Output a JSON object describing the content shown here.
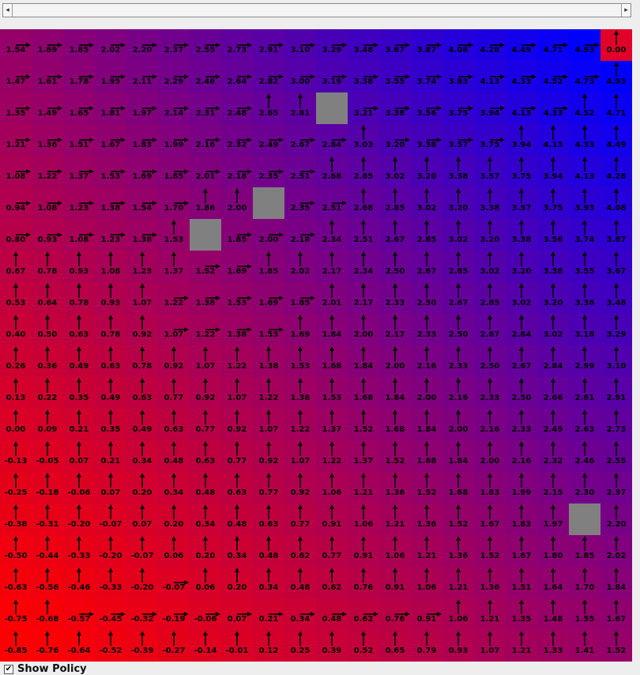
{
  "colors": {
    "low": "#ff0000",
    "high": "#0000ff",
    "obstacle": "#808080",
    "goal": "#e0002a"
  },
  "controls": {
    "show_policy_label": "Show Policy",
    "show_policy_checked": true,
    "check_glyph": "✔"
  },
  "scrollbar": {
    "left_icon": "◂",
    "right_icon": "▸"
  },
  "grid": {
    "rows": 20,
    "cols": 20,
    "goal": [
      0,
      19
    ],
    "obstacles": [
      [
        2,
        10
      ],
      [
        5,
        8
      ],
      [
        6,
        6
      ],
      [
        15,
        18
      ]
    ],
    "values": [
      [
        "1.54",
        "1.69",
        "1.85",
        "2.02",
        "2.20",
        "2.37",
        "2.55",
        "2.73",
        "2.91",
        "3.10",
        "3.29",
        "3.48",
        "3.67",
        "3.87",
        "4.08",
        "4.28",
        "4.49",
        "4.71",
        "4.93",
        "0.00"
      ],
      [
        "1.47",
        "1.61",
        "1.78",
        "1.95",
        "2.11",
        "2.29",
        "2.46",
        "2.64",
        "2.82",
        "3.00",
        "3.19",
        "3.38",
        "3.55",
        "3.74",
        "3.93",
        "4.13",
        "4.33",
        "4.52",
        "4.73",
        "4.93"
      ],
      [
        "1.35",
        "1.49",
        "1.65",
        "1.81",
        "1.97",
        "2.14",
        "2.31",
        "2.48",
        "2.65",
        "2.81",
        "",
        "3.21",
        "3.38",
        "3.56",
        "3.75",
        "3.94",
        "4.13",
        "4.33",
        "4.52",
        "4.71"
      ],
      [
        "1.21",
        "1.36",
        "1.51",
        "1.67",
        "1.83",
        "1.99",
        "2.16",
        "2.32",
        "2.49",
        "2.67",
        "2.84",
        "3.03",
        "3.20",
        "3.38",
        "3.57",
        "3.75",
        "3.94",
        "4.13",
        "4.33",
        "4.49"
      ],
      [
        "1.08",
        "1.22",
        "1.37",
        "1.53",
        "1.69",
        "1.85",
        "2.01",
        "2.18",
        "2.35",
        "2.51",
        "2.68",
        "2.85",
        "3.02",
        "3.20",
        "3.38",
        "3.57",
        "3.75",
        "3.94",
        "4.13",
        "4.28"
      ],
      [
        "0.94",
        "1.08",
        "1.23",
        "1.38",
        "1.54",
        "1.70",
        "1.86",
        "2.00",
        "",
        "2.35",
        "2.51",
        "2.68",
        "2.85",
        "3.02",
        "3.20",
        "3.38",
        "3.57",
        "3.75",
        "3.93",
        "4.08"
      ],
      [
        "0.80",
        "0.93",
        "1.08",
        "1.23",
        "1.38",
        "1.53",
        "",
        "1.85",
        "2.00",
        "2.18",
        "2.34",
        "2.51",
        "2.67",
        "2.85",
        "3.02",
        "3.20",
        "3.38",
        "3.56",
        "3.74",
        "3.87"
      ],
      [
        "0.67",
        "0.78",
        "0.93",
        "1.08",
        "1.23",
        "1.37",
        "1.52",
        "1.69",
        "1.85",
        "2.02",
        "2.17",
        "2.34",
        "2.50",
        "2.67",
        "2.85",
        "3.02",
        "3.20",
        "3.38",
        "3.55",
        "3.67"
      ],
      [
        "0.53",
        "0.64",
        "0.78",
        "0.93",
        "1.07",
        "1.22",
        "1.38",
        "1.53",
        "1.69",
        "1.85",
        "2.01",
        "2.17",
        "2.33",
        "2.50",
        "2.67",
        "2.85",
        "3.02",
        "3.20",
        "3.36",
        "3.48"
      ],
      [
        "0.40",
        "0.50",
        "0.63",
        "0.78",
        "0.92",
        "1.07",
        "1.22",
        "1.38",
        "1.53",
        "1.69",
        "1.84",
        "2.00",
        "2.17",
        "2.33",
        "2.50",
        "2.67",
        "2.84",
        "3.02",
        "3.18",
        "3.29"
      ],
      [
        "0.26",
        "0.36",
        "0.49",
        "0.63",
        "0.78",
        "0.92",
        "1.07",
        "1.22",
        "1.38",
        "1.53",
        "1.68",
        "1.84",
        "2.00",
        "2.16",
        "2.33",
        "2.50",
        "2.67",
        "2.84",
        "2.99",
        "3.10"
      ],
      [
        "0.13",
        "0.22",
        "0.35",
        "0.49",
        "0.63",
        "0.77",
        "0.92",
        "1.07",
        "1.22",
        "1.38",
        "1.53",
        "1.68",
        "1.84",
        "2.00",
        "2.16",
        "2.33",
        "2.50",
        "2.66",
        "2.81",
        "2.91"
      ],
      [
        "0.00",
        "0.09",
        "0.21",
        "0.35",
        "0.49",
        "0.63",
        "0.77",
        "0.92",
        "1.07",
        "1.22",
        "1.37",
        "1.52",
        "1.68",
        "1.84",
        "2.00",
        "2.16",
        "2.33",
        "2.49",
        "2.63",
        "2.73"
      ],
      [
        "-0.13",
        "-0.05",
        "0.07",
        "0.21",
        "0.34",
        "0.48",
        "0.63",
        "0.77",
        "0.92",
        "1.07",
        "1.22",
        "1.37",
        "1.52",
        "1.68",
        "1.84",
        "2.00",
        "2.16",
        "2.32",
        "2.46",
        "2.55"
      ],
      [
        "-0.25",
        "-0.18",
        "-0.06",
        "0.07",
        "0.20",
        "0.34",
        "0.48",
        "0.63",
        "0.77",
        "0.92",
        "1.06",
        "1.21",
        "1.36",
        "1.52",
        "1.68",
        "1.83",
        "1.99",
        "2.15",
        "2.30",
        "2.37"
      ],
      [
        "-0.38",
        "-0.31",
        "-0.20",
        "-0.07",
        "0.07",
        "0.20",
        "0.34",
        "0.48",
        "0.63",
        "0.77",
        "0.91",
        "1.06",
        "1.21",
        "1.36",
        "1.52",
        "1.67",
        "1.83",
        "1.97",
        "",
        "2.20"
      ],
      [
        "-0.50",
        "-0.44",
        "-0.33",
        "-0.20",
        "-0.07",
        "0.06",
        "0.20",
        "0.34",
        "0.48",
        "0.62",
        "0.77",
        "0.91",
        "1.06",
        "1.21",
        "1.36",
        "1.52",
        "1.67",
        "1.80",
        "1.85",
        "2.02"
      ],
      [
        "-0.63",
        "-0.56",
        "-0.46",
        "-0.33",
        "-0.20",
        "-0.07",
        "0.06",
        "0.20",
        "0.34",
        "0.48",
        "0.62",
        "0.76",
        "0.91",
        "1.06",
        "1.21",
        "1.36",
        "1.51",
        "1.64",
        "1.70",
        "1.84"
      ],
      [
        "-0.75",
        "-0.68",
        "-0.57",
        "-0.45",
        "-0.32",
        "-0.19",
        "-0.06",
        "0.07",
        "0.21",
        "0.34",
        "0.48",
        "0.62",
        "0.76",
        "0.91",
        "1.06",
        "1.21",
        "1.35",
        "1.48",
        "1.55",
        "1.67"
      ],
      [
        "-0.85",
        "-0.76",
        "-0.64",
        "-0.52",
        "-0.39",
        "-0.27",
        "-0.14",
        "-0.01",
        "0.12",
        "0.25",
        "0.39",
        "0.52",
        "0.65",
        "0.79",
        "0.93",
        "1.07",
        "1.21",
        "1.33",
        "1.41",
        "1.52"
      ]
    ],
    "policy": [
      "RRRRRRRRRRRRRRRRRRRU",
      "RRRRRRRRRRRRRRRRRRRU",
      "RRRRRRRRUU.RRRRRRRUU",
      "RRRRRRRRRRRURRRRUUUU",
      "RRRRRRRRRRUUUUUUUUUU",
      "RRRRRRUU.RRUUUUUUUUU",
      "RRRRRU.RRRUUUUUUUUUU",
      "UUUUUURRUUUUUUUUUUUU",
      "UUUUURRRRRUUUUUUUUUU",
      "UUUUURRRRUUUUUUUUUUU",
      "UUUUUUUUUUUUUUUUUUUU",
      "UUUUUUUUUUUUUUUUUUUU",
      "UUUUUUUUUUUUUUUUUUUU",
      "UUUUUUUUUUUUUUUUUUUU",
      "UUUUUUUUUUUUUUUUUUUU",
      "UUUUUUUUUUUUUUUUUU.U",
      "UUUUUUUUUUUUUUUUUUUU",
      "UUUUURUUUUUUUUUUUUUU",
      "UURRRRRRRRRRRRUUUUUU",
      "UUUUUUUUUUUUUUUUUUUU"
    ]
  }
}
